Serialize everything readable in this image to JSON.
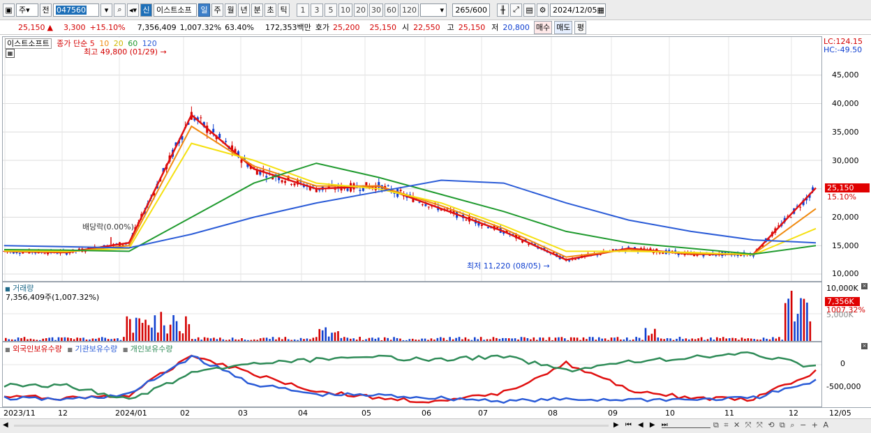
{
  "toolbar": {
    "market": "주",
    "prev_label": "전",
    "code": "047560",
    "sin_label": "신",
    "name": "이스트소프",
    "periods": [
      "일",
      "주",
      "월",
      "년",
      "분",
      "초",
      "틱"
    ],
    "minute_steps": [
      "1",
      "3",
      "5",
      "10",
      "20",
      "30",
      "60",
      "120"
    ],
    "count": "265",
    "count_max": "/600",
    "date": "2024/12/05"
  },
  "info": {
    "price": "25,150",
    "change": "3,300",
    "change_pct": "+15.10%",
    "volume": "7,356,409",
    "volume_pct": "1,007.32%",
    "ratio": "63.40%",
    "amount": "172,353백만",
    "quote_label": "호가",
    "ask": "25,200",
    "bid": "25,150",
    "open_label": "시",
    "open": "22,550",
    "high_label": "고",
    "high": "25,150",
    "low_label": "저",
    "low": "20,800",
    "buy_label": "매수",
    "sell_label": "매도",
    "eval_label": "평"
  },
  "price_panel": {
    "name": "이스트소프트",
    "legend_prefix": "종가 단순",
    "ma": [
      "5",
      "10",
      "20",
      "60",
      "120"
    ],
    "high_annotation": "최고 49,800 (01/29)",
    "low_annotation": "최저 11,220 (08/05)",
    "dividend_annotation": "배당락(0.00%)",
    "lc": "LC:124.15",
    "hc": "HC:-49.50",
    "current_tag": "25,150",
    "current_pct": "15.10%",
    "y_ticks": [
      "45,000",
      "40,000",
      "35,000",
      "30,000",
      "25,000",
      "20,000",
      "15,000",
      "10,000"
    ]
  },
  "volume_panel": {
    "title": "거래량",
    "value": "7,356,409주(1,007.32%)",
    "y_ticks": [
      "10,000K",
      "5,000K"
    ],
    "current_tag": "7,356K",
    "current_pct": "1007.32%"
  },
  "holdings_panel": {
    "series": [
      "외국인보유수량",
      "기관보유수량",
      "개인보유수량"
    ],
    "y_ticks": [
      "0",
      "-500,000"
    ]
  },
  "x_axis": {
    "labels": [
      "2023/11",
      "12",
      "2024/01",
      "02",
      "03",
      "04",
      "05",
      "06",
      "07",
      "08",
      "09",
      "10",
      "11",
      "12"
    ],
    "end_label": "12/05"
  },
  "colors": {
    "up": "#d40000",
    "down": "#1040d0",
    "ma5": "#e01010",
    "ma10": "#f08a10",
    "ma20": "#f5e010",
    "ma60": "#1f9a2e",
    "ma120": "#2a5bd7",
    "foreign": "#e01010",
    "institution": "#2a5bd7",
    "individual": "#2e8b57"
  },
  "chart_data": {
    "type": "line",
    "x": [
      "2023/11",
      "12",
      "2024/01",
      "02",
      "03",
      "04",
      "05",
      "06",
      "07",
      "08",
      "09",
      "10",
      "11",
      "12"
    ],
    "series": [
      {
        "name": "5",
        "values": [
          14000,
          13800,
          15500,
          38000,
          28500,
          25000,
          25500,
          21500,
          17500,
          12500,
          14500,
          13500,
          13500,
          25150
        ]
      },
      {
        "name": "10",
        "values": [
          14000,
          13900,
          15000,
          36000,
          29000,
          25500,
          25500,
          22000,
          18000,
          13000,
          14300,
          13600,
          13500,
          21500
        ]
      },
      {
        "name": "20",
        "values": [
          14100,
          14000,
          14500,
          33000,
          30000,
          26000,
          25000,
          22500,
          18500,
          14000,
          14000,
          13800,
          13400,
          18000
        ]
      },
      {
        "name": "60",
        "values": [
          14300,
          14200,
          14000,
          20000,
          26000,
          29500,
          27000,
          24000,
          21000,
          17500,
          15500,
          14500,
          13500,
          15000
        ]
      },
      {
        "name": "120",
        "values": [
          15000,
          14800,
          14600,
          17000,
          20000,
          22500,
          24500,
          26500,
          26000,
          22500,
          19500,
          17500,
          16000,
          15500
        ]
      }
    ],
    "ylim": [
      10000,
      50000
    ]
  }
}
